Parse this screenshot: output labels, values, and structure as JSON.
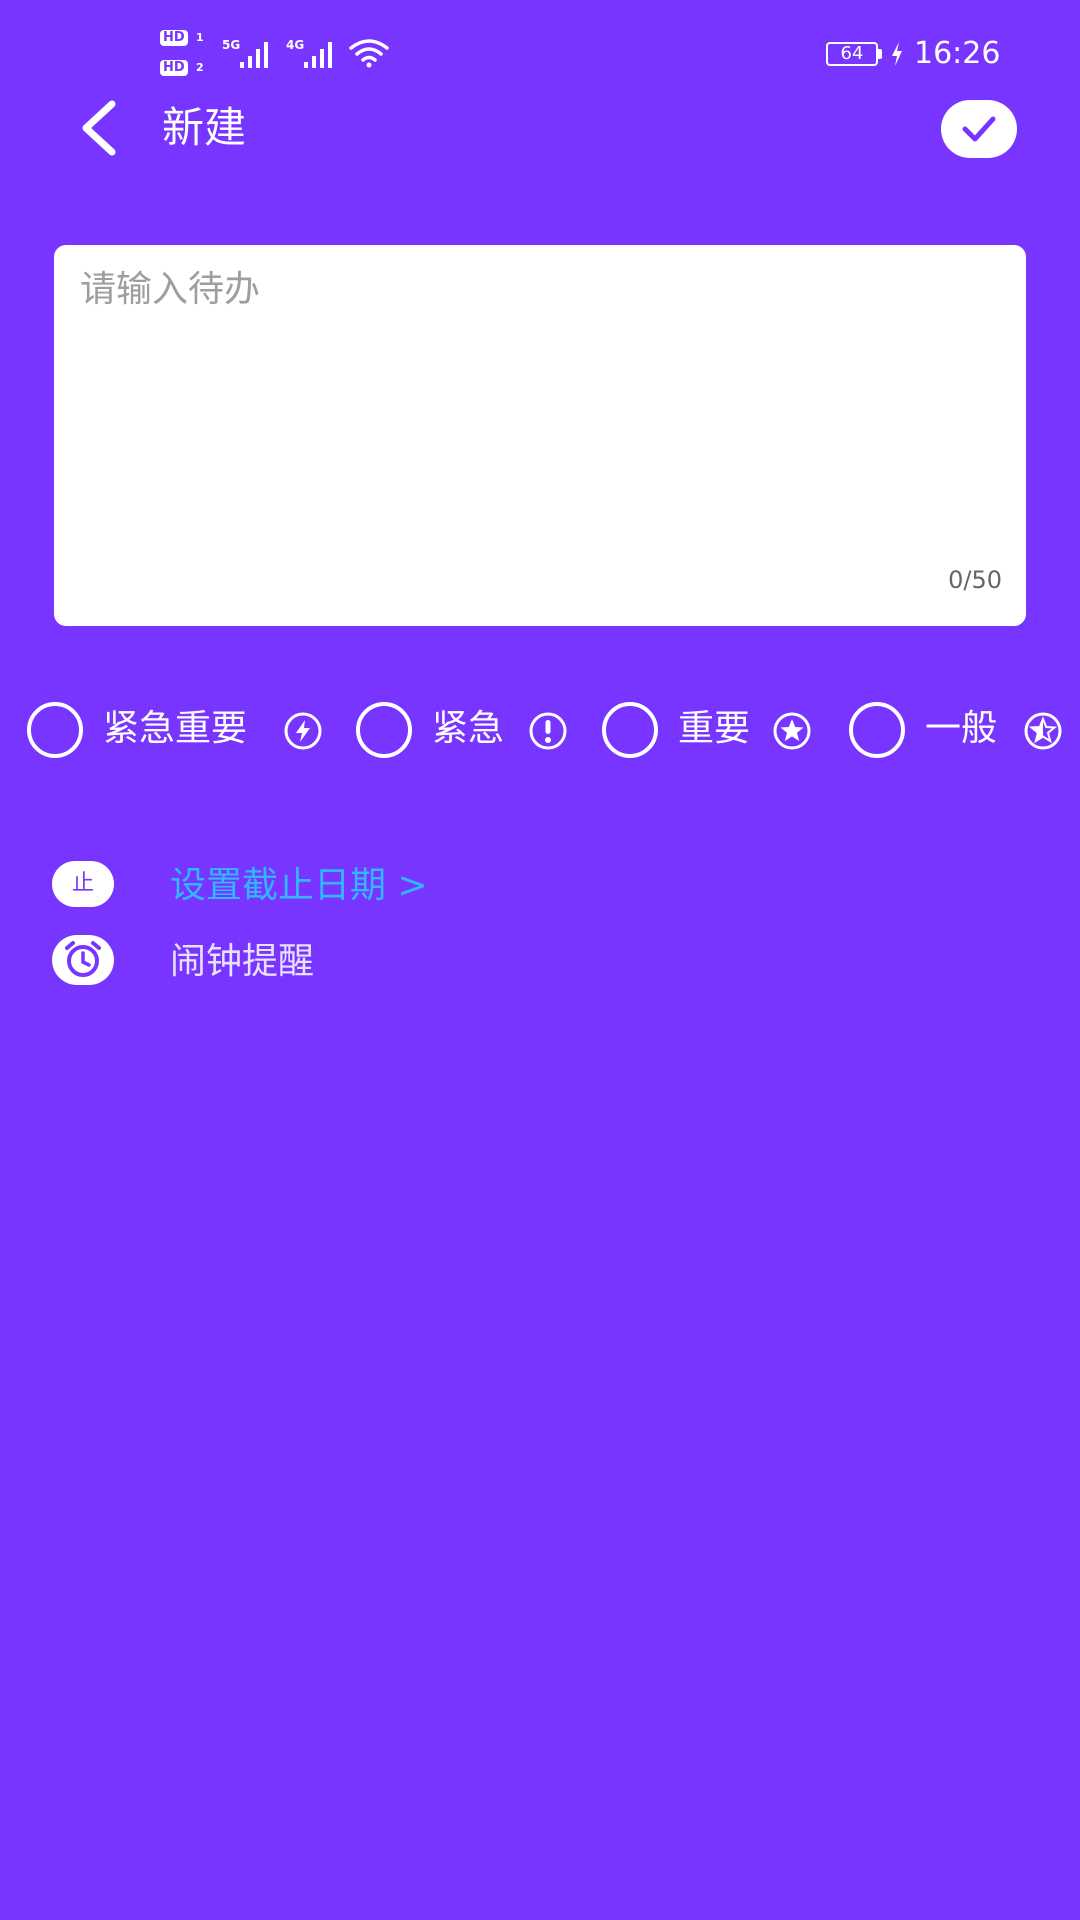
{
  "status_bar": {
    "hd1": "HD",
    "hd1_sub": "1",
    "hd2": "HD",
    "hd2_sub": "2",
    "net1": "5G",
    "net2": "4G",
    "battery": "64",
    "time": "16:26"
  },
  "toolbar": {
    "title": "新建"
  },
  "todo": {
    "placeholder": "请输入待办",
    "counter": "0/50"
  },
  "priorities": [
    {
      "label": "紧急重要",
      "icon": "bolt-circle-icon"
    },
    {
      "label": "紧急",
      "icon": "exclamation-circle-icon"
    },
    {
      "label": "重要",
      "icon": "star-circle-icon"
    },
    {
      "label": "一般",
      "icon": "half-star-circle-icon"
    }
  ],
  "settings": {
    "deadline_badge": "止",
    "deadline_label": "设置截止日期  >",
    "alarm_label": "闹钟提醒"
  },
  "colors": {
    "background": "#7835FF",
    "accent_link": "#31B7FF",
    "card": "#FFFFFF"
  }
}
